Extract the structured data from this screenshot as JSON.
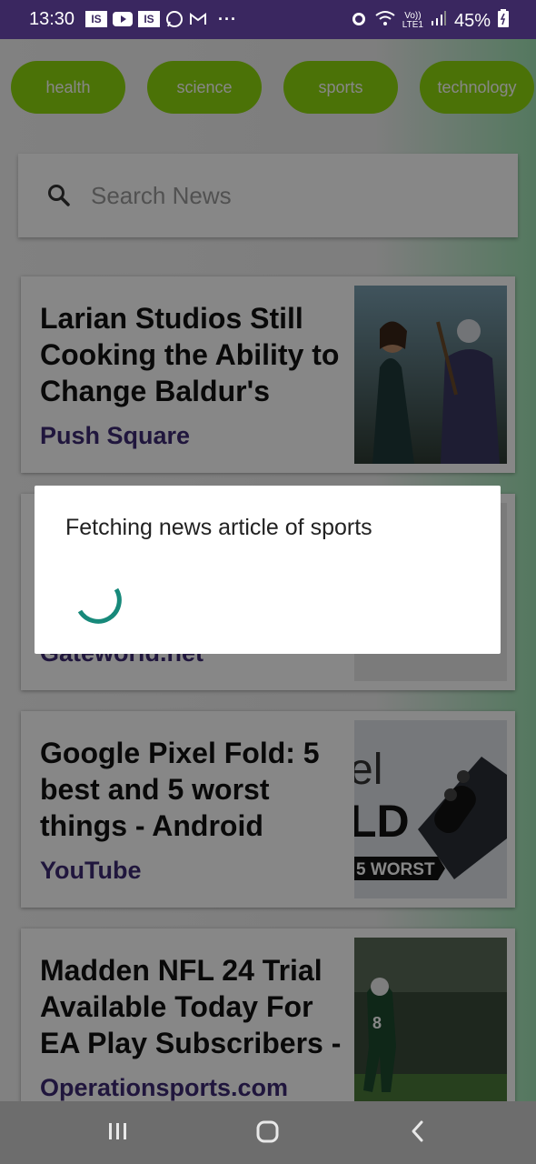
{
  "status_bar": {
    "time": "13:30",
    "left_icons": [
      "IS",
      "youtube-icon",
      "IS",
      "whatsapp-icon",
      "gmail-icon"
    ],
    "more": "···",
    "volte_top": "Vo))",
    "volte_bottom": "LTE1",
    "battery": "45%"
  },
  "categories": [
    "health",
    "science",
    "sports",
    "technology"
  ],
  "search": {
    "placeholder": "Search News"
  },
  "articles": [
    {
      "title": "Larian Studios Still Cooking the Ability to Change Baldur's",
      "source": "Push Square"
    },
    {
      "title": "",
      "source": "Gateworld.net"
    },
    {
      "title": "Google Pixel Fold: 5 best and 5 worst things - Android",
      "source": "YouTube",
      "thumb_texts": [
        "el",
        "LD",
        "5 WORST"
      ]
    },
    {
      "title": "Madden NFL 24 Trial Available Today For EA Play Subscribers -",
      "source": "Operationsports.com"
    }
  ],
  "dialog": {
    "message": "Fetching news article of sports"
  },
  "colors": {
    "chip": "#8fd80e",
    "source_text": "#3d2a73",
    "status_bar": "#3a2760",
    "spinner": "#17897a"
  }
}
